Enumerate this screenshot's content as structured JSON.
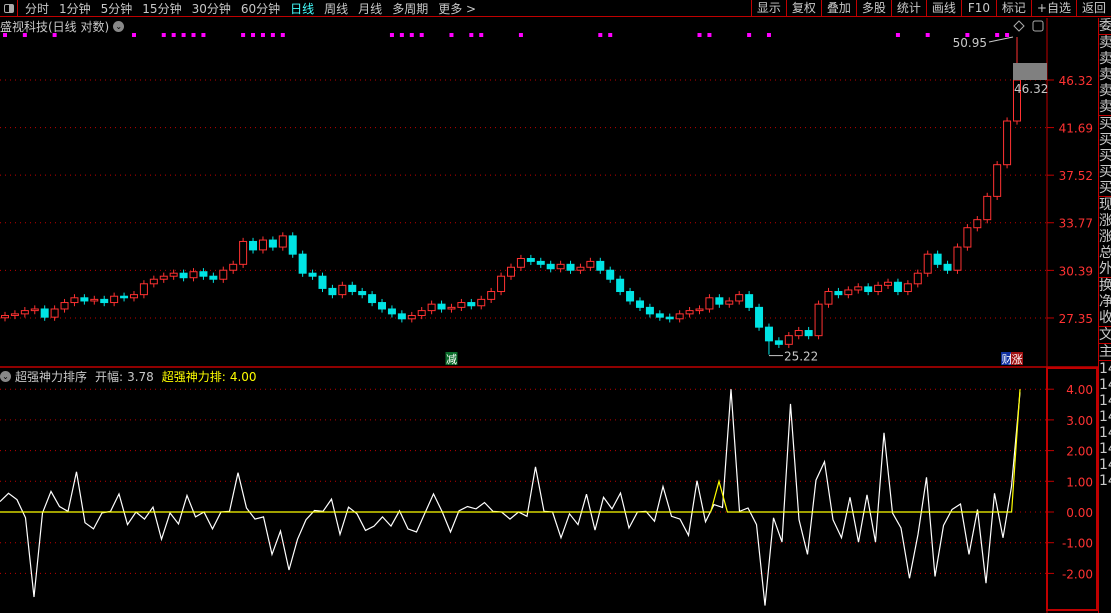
{
  "toolbar": {
    "periods": [
      "分时",
      "1分钟",
      "5分钟",
      "15分钟",
      "30分钟",
      "60分钟",
      "日线",
      "周线",
      "月线",
      "多周期",
      "更多 >"
    ],
    "active_period": "日线",
    "buttons": [
      "显示",
      "复权",
      "叠加",
      "多股",
      "统计",
      "画线",
      "F10",
      "标记",
      "+自选",
      "返回"
    ]
  },
  "chart_title": "盛视科技(日线 对数)",
  "indicator_header": {
    "name": "超强神力排序",
    "label1": "开幅:",
    "value1": "3.78",
    "label2": "超强神力排:",
    "value2": "4.00"
  },
  "sidebar": {
    "groups": [
      [
        "委"
      ],
      [
        "卖",
        "卖",
        "卖",
        "卖",
        "卖"
      ],
      [
        "买",
        "买",
        "买",
        "买",
        "买"
      ],
      [
        "现",
        "涨",
        "涨",
        "总",
        "外"
      ],
      [
        "换",
        "净",
        "收"
      ],
      [
        "文"
      ],
      [
        "主"
      ],
      [
        "14",
        "14",
        "14",
        "14",
        "14",
        "14",
        "14",
        "14"
      ]
    ]
  },
  "colors": {
    "up": "#ff3232",
    "down": "#00e4e4",
    "grid": "#c00000",
    "axis_text": "#ff3232",
    "signal": "#ff00ff",
    "indicator": "#ffffff",
    "indicator2": "#ffff00"
  },
  "chart_data": [
    {
      "type": "candlestick",
      "title": "盛视科技(日线 对数)",
      "yscale": "log",
      "yticks": [
        "46.32",
        "41.69",
        "37.52",
        "33.77",
        "30.39",
        "27.35"
      ],
      "close": [
        27.5,
        27.6,
        27.8,
        27.9,
        27.4,
        27.9,
        28.3,
        28.6,
        28.4,
        28.5,
        28.3,
        28.7,
        28.6,
        28.8,
        29.5,
        29.8,
        30.0,
        30.2,
        29.9,
        30.3,
        30.0,
        29.8,
        30.4,
        30.8,
        32.4,
        31.8,
        32.5,
        32.0,
        32.8,
        31.5,
        30.2,
        30.0,
        29.2,
        28.8,
        29.4,
        29.0,
        28.8,
        28.3,
        27.9,
        27.6,
        27.3,
        27.5,
        27.8,
        28.2,
        27.9,
        28.0,
        28.3,
        28.1,
        28.5,
        29.0,
        30.0,
        30.6,
        31.2,
        31.0,
        30.8,
        30.5,
        30.8,
        30.4,
        30.6,
        31.0,
        30.4,
        29.8,
        29.0,
        28.4,
        28.0,
        27.6,
        27.4,
        27.3,
        27.6,
        27.8,
        27.9,
        28.6,
        28.2,
        28.4,
        28.8,
        28.0,
        26.8,
        26.0,
        25.8,
        26.3,
        26.6,
        26.3,
        28.2,
        29.0,
        28.8,
        29.1,
        29.3,
        29.0,
        29.4,
        29.6,
        29.0,
        29.5,
        30.2,
        31.5,
        30.8,
        30.4,
        32.0,
        33.4,
        34.0,
        35.8,
        38.4,
        42.3,
        46.32
      ],
      "annotations": {
        "high_label": "50.95",
        "low_label": "25.22",
        "last_label": "46.32",
        "high": 50.95,
        "low": 25.22,
        "low_index": 77
      },
      "signal_indices": [
        0,
        2,
        5,
        13,
        16,
        17,
        18,
        19,
        20,
        24,
        25,
        26,
        27,
        28,
        39,
        40,
        41,
        42,
        45,
        47,
        48,
        52,
        60,
        61,
        70,
        71,
        75,
        77,
        90,
        93,
        97,
        100,
        101
      ],
      "markers": [
        {
          "index": 45,
          "text": "减",
          "kind": "reduce"
        },
        {
          "index": 101,
          "text": "财",
          "kind": "finance"
        },
        {
          "index": 102,
          "text": "涨",
          "kind": "rise"
        }
      ]
    },
    {
      "type": "line",
      "title": "超强神力排序",
      "yticks": [
        "4.00",
        "3.00",
        "2.00",
        "1.00",
        "0.00",
        "-1.00",
        "-2.00"
      ],
      "ylim": [
        -3.1,
        4.1
      ],
      "series": [
        {
          "name": "开幅",
          "values": [
            0.34,
            0.61,
            0.4,
            -0.19,
            -2.77,
            -0.03,
            0.67,
            0.18,
            0.02,
            1.31,
            -0.35,
            -0.55,
            -0.03,
            0.02,
            0.59,
            -0.41,
            0,
            -0.23,
            0.16,
            -0.89,
            -0.03,
            -0.39,
            0.54,
            -0.16,
            0,
            -0.55,
            0,
            0.02,
            1.28,
            0.13,
            -0.23,
            -0.16,
            -1.38,
            -0.62,
            -1.89,
            -0.89,
            -0.25,
            0.05,
            0.02,
            0.42,
            -0.73,
            0.16,
            -0.06,
            -0.6,
            -0.46,
            -0.16,
            -0.46,
            0.04,
            -0.55,
            -0.65,
            -0.03,
            0.59,
            0.02,
            -0.65,
            0.04,
            0.18,
            0.1,
            0.31,
            0.02,
            0,
            -0.23,
            0,
            -0.14,
            1.47,
            0.02,
            0,
            -0.84,
            -0.06,
            -0.41,
            0.58,
            -0.59,
            0.48,
            0.1,
            0.62,
            -0.52,
            0,
            0.02,
            -0.3,
            0.83,
            -0.14,
            -0.23,
            -0.76,
            1.02,
            -0.32,
            0.24,
            0.15,
            4.0,
            0.02,
            0.13,
            -0.41,
            -3.05,
            -0.19,
            -0.98,
            3.52,
            -0.25,
            -1.38,
            1.04,
            1.64,
            -0.25,
            -0.84,
            0.48,
            -0.98,
            0.56,
            -0.98,
            2.58,
            -0.03,
            -0.52,
            -2.16,
            -0.73,
            1.13,
            -2.1,
            -0.44,
            0.08,
            0.26,
            -1.38,
            0.08,
            -2.32,
            0.61,
            -0.84,
            0.83,
            3.9
          ]
        },
        {
          "name": "超强神力排",
          "values": [
            0,
            0,
            0,
            0,
            0,
            0,
            0,
            0,
            0,
            0,
            0,
            0,
            0,
            0,
            0,
            0,
            0,
            0,
            0,
            0,
            0,
            0,
            0,
            0,
            0,
            0,
            0,
            0,
            0,
            0,
            0,
            0,
            0,
            0,
            0,
            0,
            0,
            0,
            0,
            0,
            0,
            0,
            0,
            0,
            0,
            0,
            0,
            0,
            0,
            0,
            0,
            0,
            0,
            0,
            0,
            0,
            0,
            0,
            0,
            0,
            0,
            0,
            0,
            0,
            0,
            0,
            0,
            0,
            0,
            0,
            0,
            0,
            0,
            0,
            0,
            0,
            0,
            0,
            0,
            0,
            0,
            0,
            0,
            0,
            0,
            0,
            1.0,
            0,
            0,
            0,
            0,
            0,
            0,
            0,
            0,
            0,
            0,
            0,
            0,
            0,
            0,
            0,
            0,
            0,
            0,
            0,
            0,
            0,
            0,
            0,
            0,
            0,
            0,
            0,
            0,
            0,
            0,
            0,
            0,
            0,
            0,
            0,
            4.0
          ]
        }
      ]
    }
  ]
}
